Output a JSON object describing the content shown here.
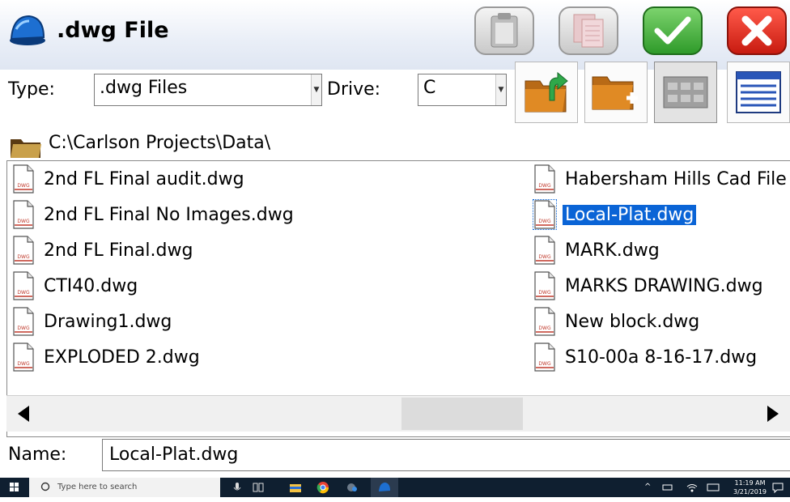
{
  "window": {
    "title": ".dwg File"
  },
  "toolbar": {
    "buttons": [
      "copy",
      "paste",
      "ok",
      "cancel"
    ],
    "colors": {
      "ok": "#2f9b2a",
      "cancel": "#c81b10"
    }
  },
  "filters": {
    "type_label": "Type:",
    "type_value": ".dwg Files",
    "drive_label": "Drive:",
    "drive_value": "C"
  },
  "actions": [
    "up-folder",
    "new-folder",
    "list-view",
    "details-view"
  ],
  "path": "C:\\Carlson Projects\\Data\\",
  "files": {
    "left": [
      "2nd FL Final audit.dwg",
      "2nd FL Final No Images.dwg",
      "2nd FL Final.dwg",
      "CTI40.dwg",
      "Drawing1.dwg",
      "EXPLODED 2.dwg"
    ],
    "right": [
      "Habersham Hills Cad File",
      "Local-Plat.dwg",
      "MARK.dwg",
      "MARKS DRAWING.dwg",
      "New block.dwg",
      "S10-00a 8-16-17.dwg"
    ],
    "selected": "Local-Plat.dwg",
    "selection_color": "#0a64d6"
  },
  "name": {
    "label": "Name:",
    "value": "Local-Plat.dwg"
  },
  "taskbar": {
    "search_placeholder": "Type here to search",
    "time": "11:19 AM",
    "date": "3/21/2019"
  }
}
